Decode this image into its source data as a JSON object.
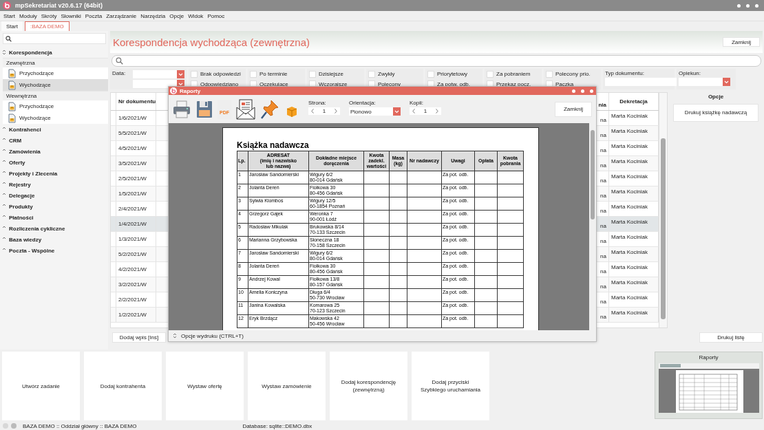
{
  "window": {
    "title": "mpSekretariat v20.6.17 (64bit)"
  },
  "menu": [
    "Start",
    "Moduły",
    "Skróty",
    "Słowniki",
    "Poczta",
    "Zarządzanie",
    "Narzędzia",
    "Opcje",
    "Widok",
    "Pomoc"
  ],
  "tabs": [
    {
      "label": "Start",
      "selected": false
    },
    {
      "label": ":BAZA DEMO",
      "selected": true
    }
  ],
  "sidebar": {
    "sections": [
      {
        "label": "Korespondencja",
        "expanded": true,
        "groups": [
          {
            "label": "Zewnętrzna",
            "items": [
              {
                "label": "Przychodzące",
                "selected": false
              },
              {
                "label": "Wychodzące",
                "selected": true
              }
            ]
          },
          {
            "label": "Wewnętrzna",
            "items": [
              {
                "label": "Przychodzące",
                "selected": false
              },
              {
                "label": "Wychodzące",
                "selected": false
              }
            ]
          }
        ]
      },
      {
        "label": "Kontrahenci",
        "expanded": false
      },
      {
        "label": "CRM",
        "expanded": false
      },
      {
        "label": "Zamówienia",
        "expanded": false
      },
      {
        "label": "Oferty",
        "expanded": false
      },
      {
        "label": "Projekty i Zlecenia",
        "expanded": false
      },
      {
        "label": "Rejestry",
        "expanded": false
      },
      {
        "label": "Delegacje",
        "expanded": false
      },
      {
        "label": "Produkty",
        "expanded": false
      },
      {
        "label": "Płatności",
        "expanded": false
      },
      {
        "label": "Rozliczenia cykliczne",
        "expanded": false
      },
      {
        "label": "Baza wiedzy",
        "expanded": false
      },
      {
        "label": "Poczta - Wspólne",
        "expanded": false
      }
    ]
  },
  "header": {
    "title": "Korespondencja wychodząca (zewnętrzna)",
    "close_button": "Zamknij"
  },
  "filters": {
    "date_label": "Data:",
    "groups": [
      [
        {
          "label": "Brak odpowiedzi",
          "checked": false
        },
        {
          "label": "Odpowiedziano",
          "checked": false
        }
      ],
      [
        {
          "label": "Po terminie",
          "checked": false
        },
        {
          "label": "Oczekujące",
          "checked": false
        }
      ],
      [
        {
          "label": "Dzisiejsze",
          "checked": false
        },
        {
          "label": "Wczorajsze",
          "checked": false
        }
      ],
      [
        {
          "label": "Zwykły",
          "checked": false
        },
        {
          "label": "Polecony",
          "checked": false
        }
      ],
      [
        {
          "label": "Priorytetowy",
          "checked": false
        },
        {
          "label": "Za potw. odb.",
          "checked": false
        }
      ],
      [
        {
          "label": "Za pobraniem",
          "checked": false
        },
        {
          "label": "Przekaz pocz.",
          "checked": false
        }
      ],
      [
        {
          "label": "Polecony prio.",
          "checked": false
        },
        {
          "label": "Paczka",
          "checked": false
        }
      ]
    ],
    "document_type_label": "Typ dokumentu:",
    "owner_label": "Opiekun:"
  },
  "table": {
    "columns": [
      "Nr dokumentu",
      "nia",
      "Dekretacja"
    ],
    "rows": [
      {
        "number": "1/6/2021/W",
        "column_2": "na",
        "assignee": "Marta Kociniak",
        "selected": false
      },
      {
        "number": "5/5/2021/W",
        "column_2": "na",
        "assignee": "Marta Kociniak",
        "selected": false
      },
      {
        "number": "4/5/2021/W",
        "column_2": "na",
        "assignee": "Marta Kociniak",
        "selected": false
      },
      {
        "number": "3/5/2021/W",
        "column_2": "na",
        "assignee": "Marta Kociniak",
        "selected": false
      },
      {
        "number": "2/5/2021/W",
        "column_2": "na",
        "assignee": "Marta Kociniak",
        "selected": false
      },
      {
        "number": "1/5/2021/W",
        "column_2": "na",
        "assignee": "Marta Kociniak",
        "selected": false
      },
      {
        "number": "2/4/2021/W",
        "column_2": "na",
        "assignee": "Marta Kociniak",
        "selected": false
      },
      {
        "number": "1/4/2021/W",
        "column_2": "na",
        "assignee": "Marta Kociniak",
        "selected": true
      },
      {
        "number": "1/3/2021/W",
        "column_2": "na",
        "assignee": "Marta Kociniak",
        "selected": false
      },
      {
        "number": "5/2/2021/W",
        "column_2": "na",
        "assignee": "Marta Kociniak",
        "selected": false
      },
      {
        "number": "4/2/2021/W",
        "column_2": "na",
        "assignee": "Marta Kociniak",
        "selected": false
      },
      {
        "number": "3/2/2021/W",
        "column_2": "na",
        "assignee": "Marta Kociniak",
        "selected": false
      },
      {
        "number": "2/2/2021/W",
        "column_2": "na",
        "assignee": "Marta Kociniak",
        "selected": false
      },
      {
        "number": "1/2/2021/W",
        "column_2": "na",
        "assignee": "Marta Kociniak",
        "selected": false
      }
    ]
  },
  "options_panel": {
    "title": "Opcje",
    "buttons": [
      "Drukuj książkę nadawczą"
    ]
  },
  "add_button": "Dodaj wpis [Ins]",
  "print_list_button": "Drukuj listę",
  "dialog": {
    "title": "Raporty",
    "toolbar": {
      "pdf_label": "PDF",
      "page_label": "Strona:",
      "page": "1",
      "orientation_label": "Orientacja:",
      "orientation": "Pionowo",
      "copies_label": "Kopii:",
      "copies": "1",
      "close_button": "Zamknij"
    },
    "report": {
      "title": "Książka nadawcza",
      "columns": [
        "Lp.",
        "ADRESAT\n(imię i nazwisko\nlub nazwa)",
        "Dokładne miejsce\ndoręczenia",
        "Kwota\nzadekl.\nwartości",
        "Masa\n(kg)",
        "Nr nadawczy",
        "Uwagi",
        "Opłata",
        "Kwota\npobrania"
      ],
      "rows": [
        {
          "lp": "1",
          "name": "Jarosław Sandomierski",
          "address": "Wigury 6/2\n80-014 Gdańsk",
          "notes": "Za pot. odb."
        },
        {
          "lp": "2",
          "name": "Jolanta Dereń",
          "address": "Fiołkowa 30\n80-456 Gdańsk",
          "notes": "Za pot. odb."
        },
        {
          "lp": "3",
          "name": "Sylwia Klombos",
          "address": "Wigury 12/5\n60-1854 Poznań",
          "notes": "Za pot. odb."
        },
        {
          "lp": "4",
          "name": "Grzegorz Gajek",
          "address": "Weronka 7\n90-001 Łódź",
          "notes": "Za pot. odb."
        },
        {
          "lp": "5",
          "name": "Radosław Mikulak",
          "address": "Brukowska 8/14\n70-133 Szczecin",
          "notes": "Za pot. odb."
        },
        {
          "lp": "6",
          "name": "Marianna Grzybowska",
          "address": "Słoneczna 18\n70-158 Szczecin",
          "notes": "Za pot. odb."
        },
        {
          "lp": "7",
          "name": "Jarosław Sandomierski",
          "address": "Wigury 6/2\n80-014 Gdańsk",
          "notes": "Za pot. odb."
        },
        {
          "lp": "8",
          "name": "Jolanta Dereń",
          "address": "Fiołkowa 30\n80-456 Gdańsk",
          "notes": "Za pot. odb."
        },
        {
          "lp": "9",
          "name": "Andrzej Kowal",
          "address": "Fiołkowa 13/8\n80-157 Gdańsk",
          "notes": "Za pot. odb."
        },
        {
          "lp": "10",
          "name": "Amelia Koniczyna",
          "address": "Długa 6/4\n50-730 Wrocław",
          "notes": "Za pot. odb."
        },
        {
          "lp": "11",
          "name": "Janina Kowalska",
          "address": "Komarowa 25\n70-123 Szczecin",
          "notes": "Za pot. odb."
        },
        {
          "lp": "12",
          "name": "Eryk Brzdącz",
          "address": "Makowska 42\n50-456 Wrocław",
          "notes": "Za pot. odb."
        }
      ]
    },
    "footer": "Opcje wydruku (CTRL+T)"
  },
  "tiles": [
    "Utwórz zadanie",
    "Dodaj kontrahenta",
    "Wystaw ofertę",
    "Wystaw zamówienie",
    "Dodaj korespondencję\n(zewnętrzną)",
    "Dodaj przyciski\nSzybkiego uruchamiania"
  ],
  "thumbnail": {
    "title": "Raporty"
  },
  "status_bar": {
    "company": "BAZA DEMO :: Oddział główny :: BAZA DEMO",
    "database": "Database: sqlite::DEMO.dbx"
  }
}
